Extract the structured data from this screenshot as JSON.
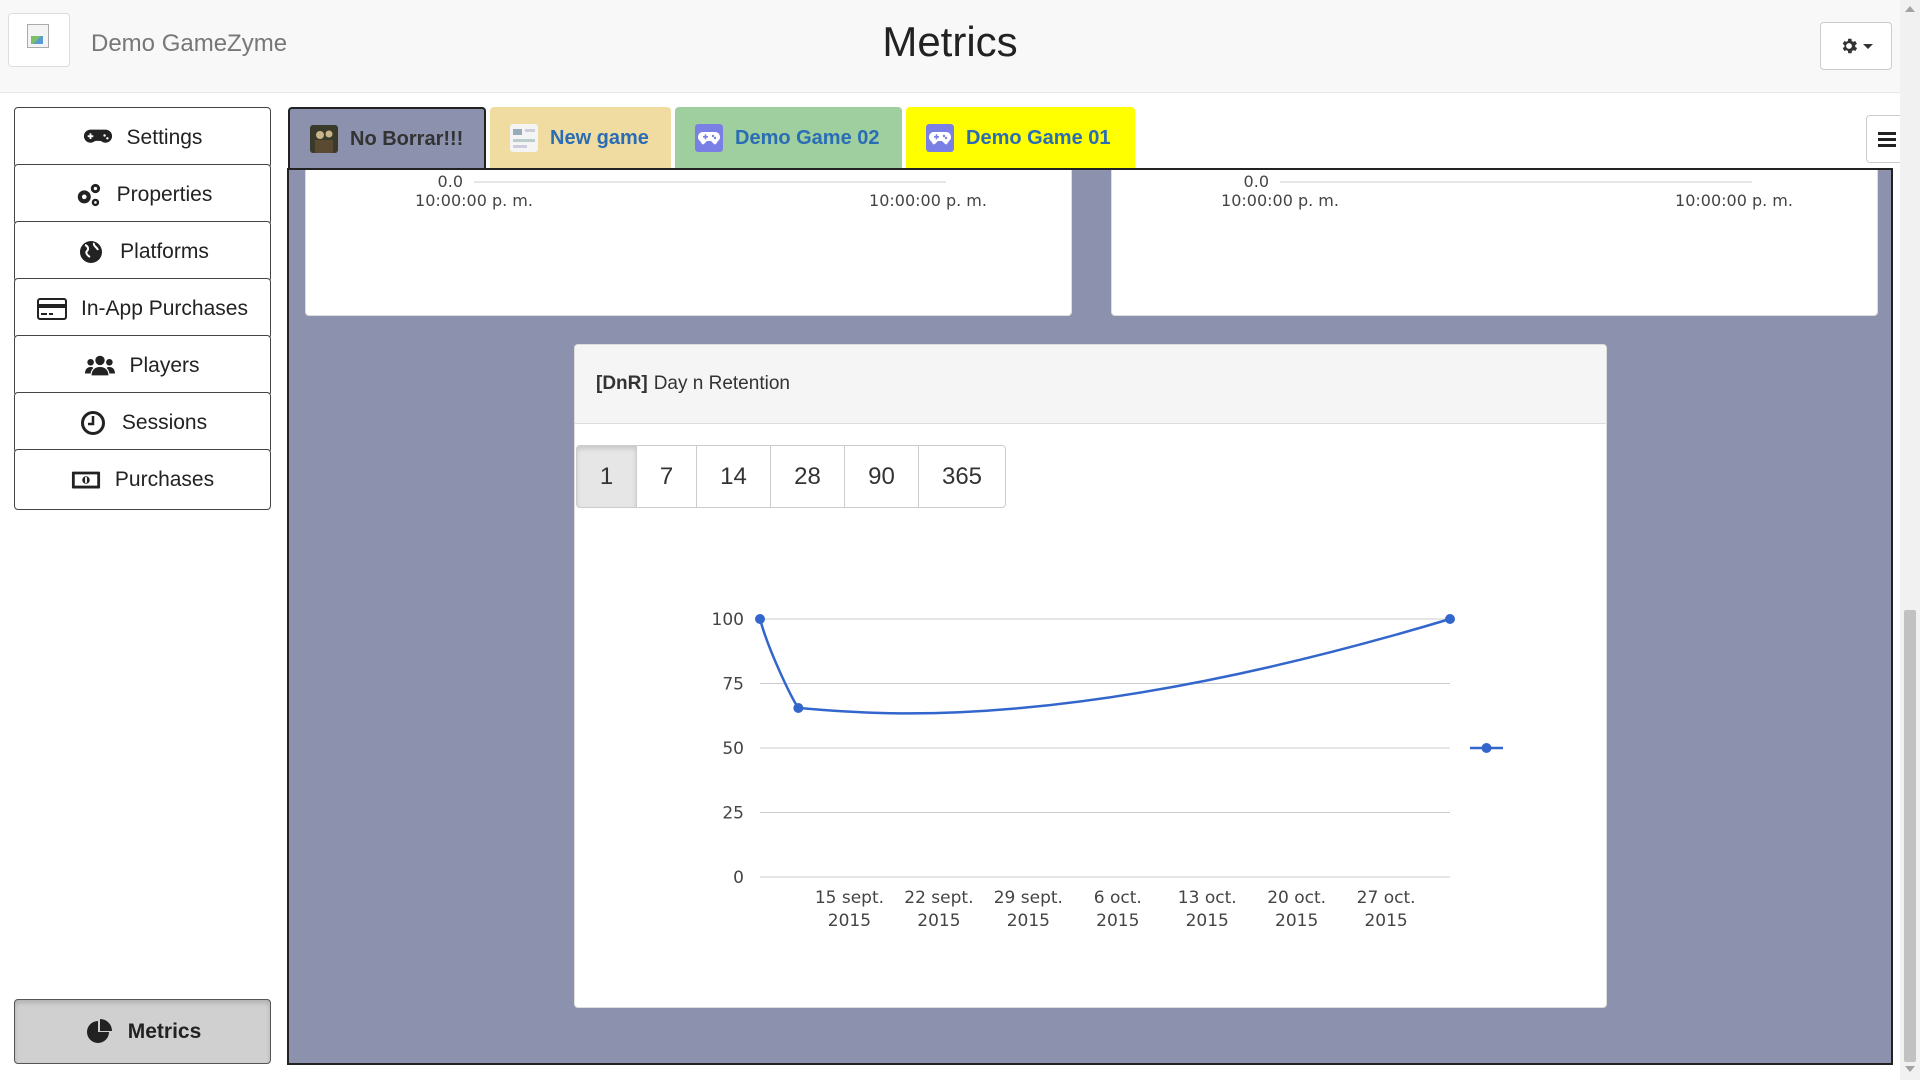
{
  "header": {
    "brand": "Demo GameZyme",
    "title": "Metrics",
    "settings_icon": "gear-icon"
  },
  "sidebar": {
    "items": [
      {
        "label": "Settings",
        "icon": "gamepad-icon"
      },
      {
        "label": "Properties",
        "icon": "cogs-icon"
      },
      {
        "label": "Platforms",
        "icon": "globe-icon"
      },
      {
        "label": "In-App Purchases",
        "icon": "credit-card-icon"
      },
      {
        "label": "Players",
        "icon": "users-icon"
      },
      {
        "label": "Sessions",
        "icon": "clock-icon"
      },
      {
        "label": "Purchases",
        "icon": "money-icon"
      }
    ],
    "active_item": {
      "label": "Metrics",
      "icon": "pie-chart-icon"
    }
  },
  "tabs": [
    {
      "label": "No Borrar!!!",
      "color": "#8c91ad"
    },
    {
      "label": "New game",
      "color": "#f0dca0"
    },
    {
      "label": "Demo Game 02",
      "color": "#9fcf9f"
    },
    {
      "label": "Demo Game 01",
      "color": "#ffff00"
    }
  ],
  "mini_panels": [
    {
      "y_tick": "0.0",
      "x_ticks": [
        "10:00:00 p. m.",
        "10:00:00 p. m."
      ]
    },
    {
      "y_tick": "0.0",
      "x_ticks": [
        "10:00:00 p. m.",
        "10:00:00 p. m."
      ]
    }
  ],
  "dnr": {
    "code": "[DnR]",
    "title": "Day n Retention",
    "day_buttons": [
      "1",
      "7",
      "14",
      "28",
      "90",
      "365"
    ],
    "active_day": "1"
  },
  "chart_data": {
    "type": "line",
    "x": [
      "2015-09-08",
      "2015-09-11",
      "2015-11-01"
    ],
    "values": [
      100,
      65.5,
      100
    ],
    "x_ticks": [
      {
        "date": "2015-09-15",
        "label": [
          "15 sept.",
          "2015"
        ]
      },
      {
        "date": "2015-09-22",
        "label": [
          "22 sept.",
          "2015"
        ]
      },
      {
        "date": "2015-09-29",
        "label": [
          "29 sept.",
          "2015"
        ]
      },
      {
        "date": "2015-10-06",
        "label": [
          "6 oct.",
          "2015"
        ]
      },
      {
        "date": "2015-10-13",
        "label": [
          "13 oct.",
          "2015"
        ]
      },
      {
        "date": "2015-10-20",
        "label": [
          "20 oct.",
          "2015"
        ]
      },
      {
        "date": "2015-10-27",
        "label": [
          "27 oct.",
          "2015"
        ]
      }
    ],
    "y_ticks": [
      0,
      25,
      50,
      75,
      100
    ],
    "xlim": [
      "2015-09-08",
      "2015-11-01"
    ],
    "ylim": [
      0,
      100
    ],
    "grid": true,
    "legend": "right",
    "series_color": "#3366cc"
  }
}
